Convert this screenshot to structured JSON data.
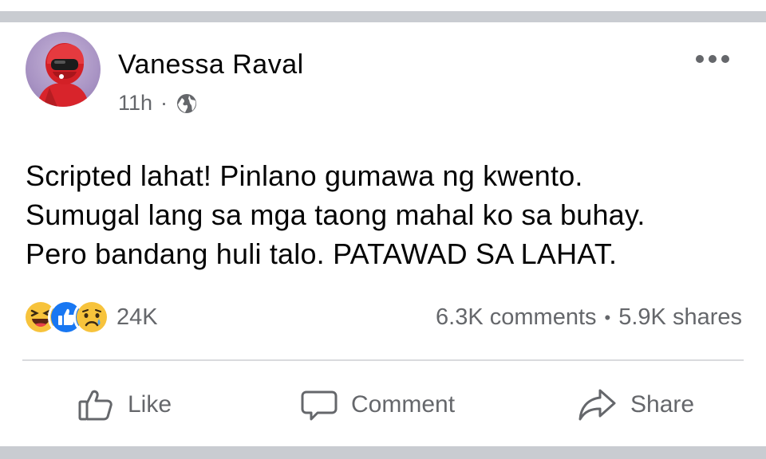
{
  "post": {
    "author": "Vanessa Raval",
    "time": "11h",
    "separator": "·",
    "privacy_icon": "globe-icon",
    "more_icon": "more-horizontal-icon",
    "text_lines": [
      "Scripted lahat! Pinlano gumawa ng kwento.",
      "Sumugal lang sa mga taong mahal ko sa buhay.",
      "Pero bandang huli talo. PATAWAD SA LAHAT."
    ]
  },
  "reactions": {
    "icons": [
      "haha-icon",
      "like-icon",
      "sad-icon"
    ],
    "count": "24K",
    "comments": "6.3K comments",
    "stats_separator": "•",
    "shares": "5.9K shares"
  },
  "actions": {
    "like": "Like",
    "comment": "Comment",
    "share": "Share"
  },
  "colors": {
    "text_primary": "#050505",
    "text_secondary": "#65676b",
    "like_blue": "#1877f2",
    "reaction_yellow": "#f7c33c",
    "divider_band": "#c9ccd1"
  }
}
